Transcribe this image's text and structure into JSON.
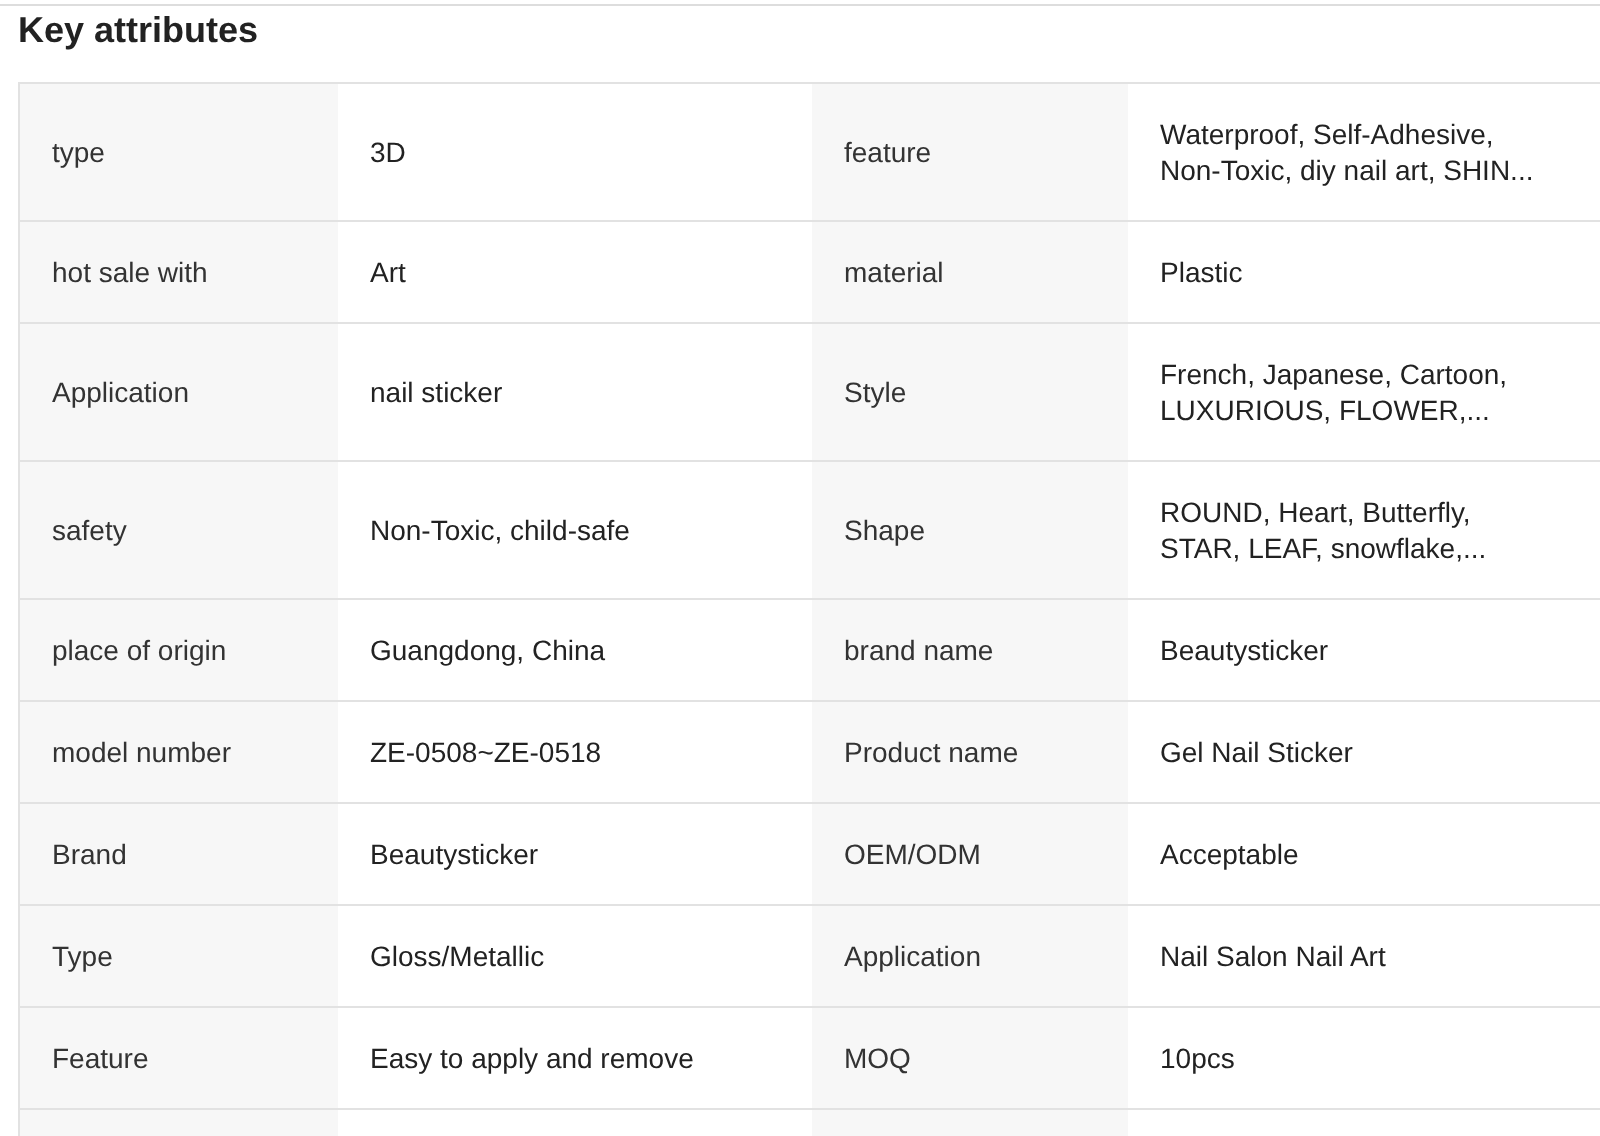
{
  "title": "Key attributes",
  "rows": [
    [
      {
        "label": "type",
        "value": "3D"
      },
      {
        "label": "feature",
        "value": "Waterproof, Self-Adhesive, Non-Toxic, diy nail art, SHIN..."
      }
    ],
    [
      {
        "label": "hot sale with",
        "value": "Art"
      },
      {
        "label": "material",
        "value": "Plastic"
      }
    ],
    [
      {
        "label": "Application",
        "value": "nail sticker"
      },
      {
        "label": "Style",
        "value": "French, Japanese, Cartoon, LUXURIOUS, FLOWER,..."
      }
    ],
    [
      {
        "label": "safety",
        "value": "Non-Toxic, child-safe"
      },
      {
        "label": "Shape",
        "value": "ROUND, Heart, Butterfly, STAR, LEAF, snowflake,..."
      }
    ],
    [
      {
        "label": "place of origin",
        "value": "Guangdong, China"
      },
      {
        "label": "brand name",
        "value": "Beautysticker"
      }
    ],
    [
      {
        "label": "model number",
        "value": "ZE-0508~ZE-0518"
      },
      {
        "label": "Product name",
        "value": "Gel Nail Sticker"
      }
    ],
    [
      {
        "label": "Brand",
        "value": "Beautysticker"
      },
      {
        "label": "OEM/ODM",
        "value": "Acceptable"
      }
    ],
    [
      {
        "label": "Type",
        "value": "Gloss/Metallic"
      },
      {
        "label": "Application",
        "value": "Nail Salon Nail Art"
      }
    ],
    [
      {
        "label": "Feature",
        "value": "Easy to apply and remove"
      },
      {
        "label": "MOQ",
        "value": "10pcs"
      }
    ]
  ]
}
